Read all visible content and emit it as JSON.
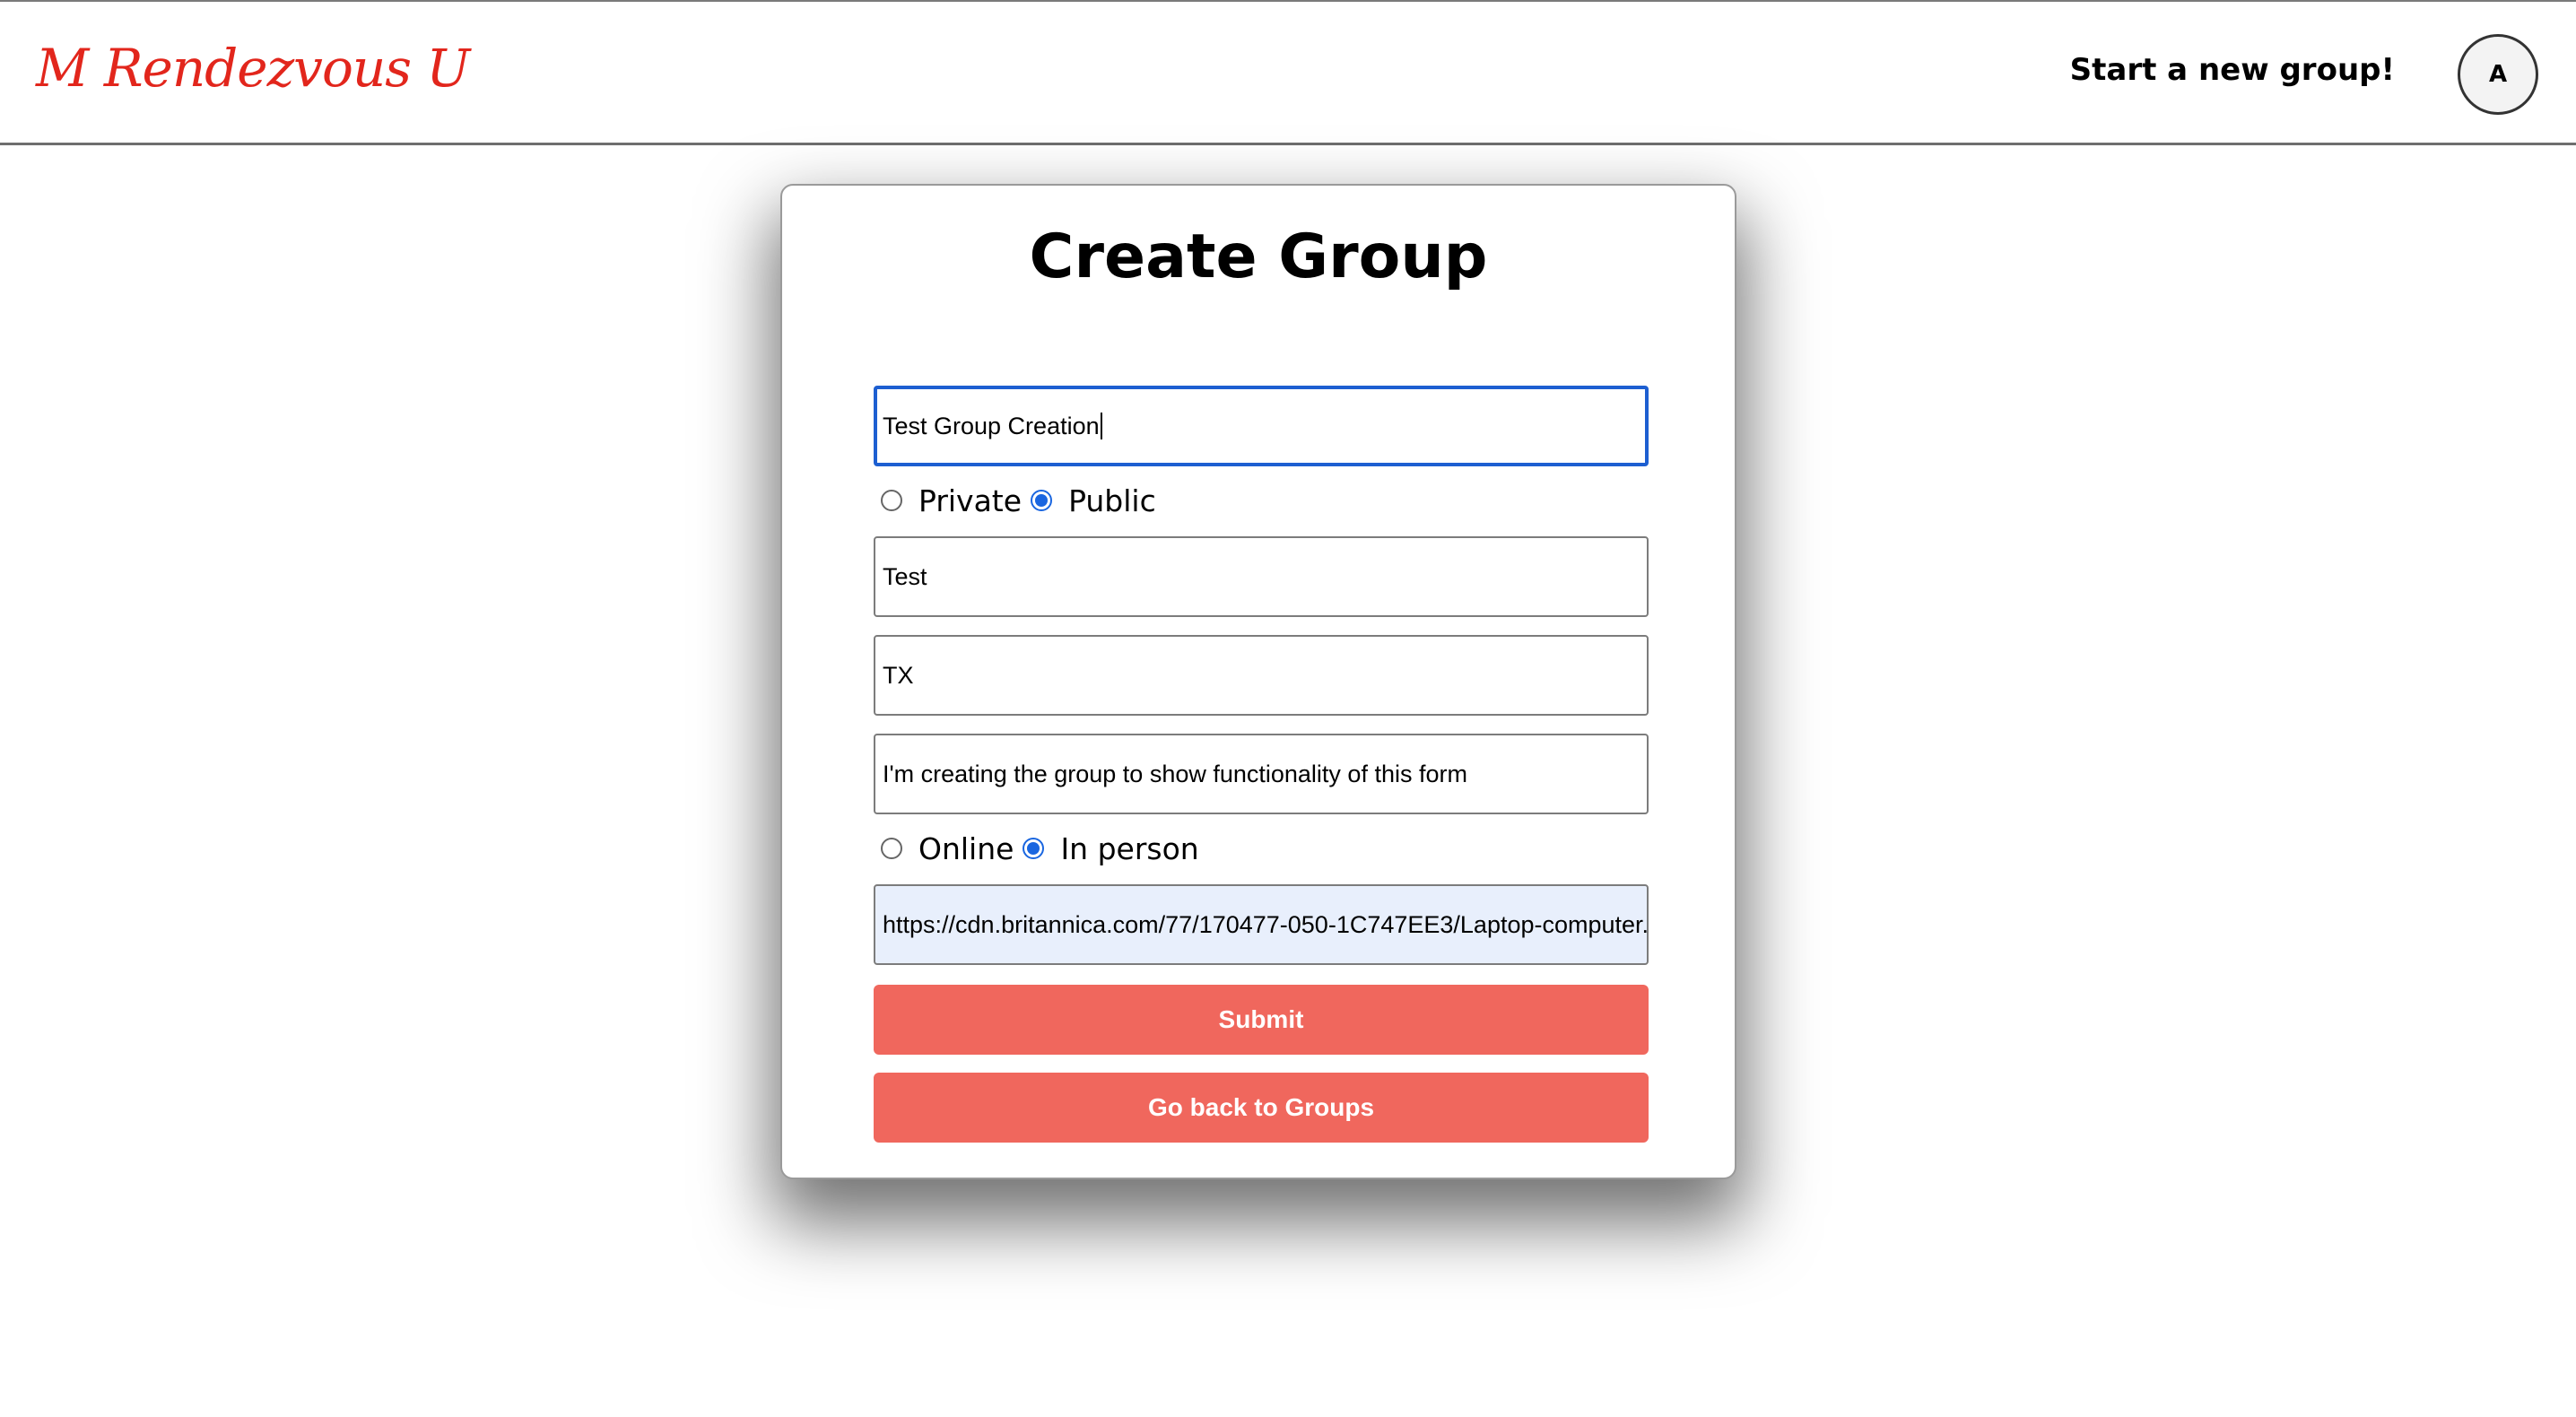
{
  "header": {
    "logo": "M Rendezvous U",
    "start_link": "Start a new group!",
    "avatar_initial": "A"
  },
  "form": {
    "title": "Create Group",
    "name_value": "Test Group Creation",
    "privacy": {
      "private_label": "Private",
      "public_label": "Public",
      "selected": "Public"
    },
    "city_value": "Test",
    "state_value": "TX",
    "about_value": "I'm creating the group to show functionality of this form",
    "type": {
      "online_label": "Online",
      "in_person_label": "In person",
      "selected": "In person"
    },
    "image_url_value": "https://cdn.britannica.com/77/170477-050-1C747EE3/Laptop-computer.j",
    "submit_label": "Submit",
    "back_label": "Go back to Groups"
  },
  "colors": {
    "logo": "#e2261c",
    "button": "#f0675d",
    "focus": "#1d5fd1",
    "radio_checked": "#1a66e0"
  }
}
